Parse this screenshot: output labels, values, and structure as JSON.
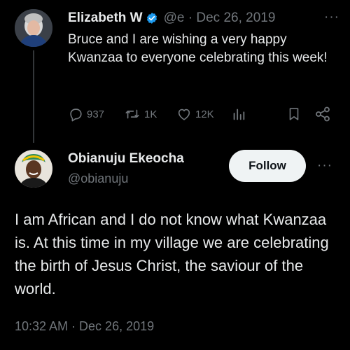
{
  "parent_tweet": {
    "author_name": "Elizabeth W",
    "handle": "@e",
    "separator": "·",
    "date": "Dec 26, 2019",
    "more": "···",
    "text": "Bruce and I are wishing a very happy Kwanzaa to everyone celebrating this week!",
    "actions": {
      "replies": "937",
      "reposts": "1K",
      "likes": "12K"
    },
    "icons": [
      "verified-badge-icon",
      "reply-icon",
      "repost-icon",
      "like-icon",
      "views-icon",
      "bookmark-icon",
      "share-icon"
    ],
    "colors": {
      "verified": "#1d9bf0"
    }
  },
  "reply_tweet": {
    "author_name": "Obianuju Ekeocha",
    "handle": "@obianuju",
    "follow_label": "Follow",
    "more": "···",
    "text": "I am African and I do not know what Kwanzaa is. At this time in my village we are celebrating the birth of Jesus Christ, the saviour of the world.",
    "timestamp": "10:32 AM · Dec 26, 2019"
  },
  "theme": {
    "background": "#000000",
    "text": "#e7e9ea",
    "muted": "#71767b"
  }
}
